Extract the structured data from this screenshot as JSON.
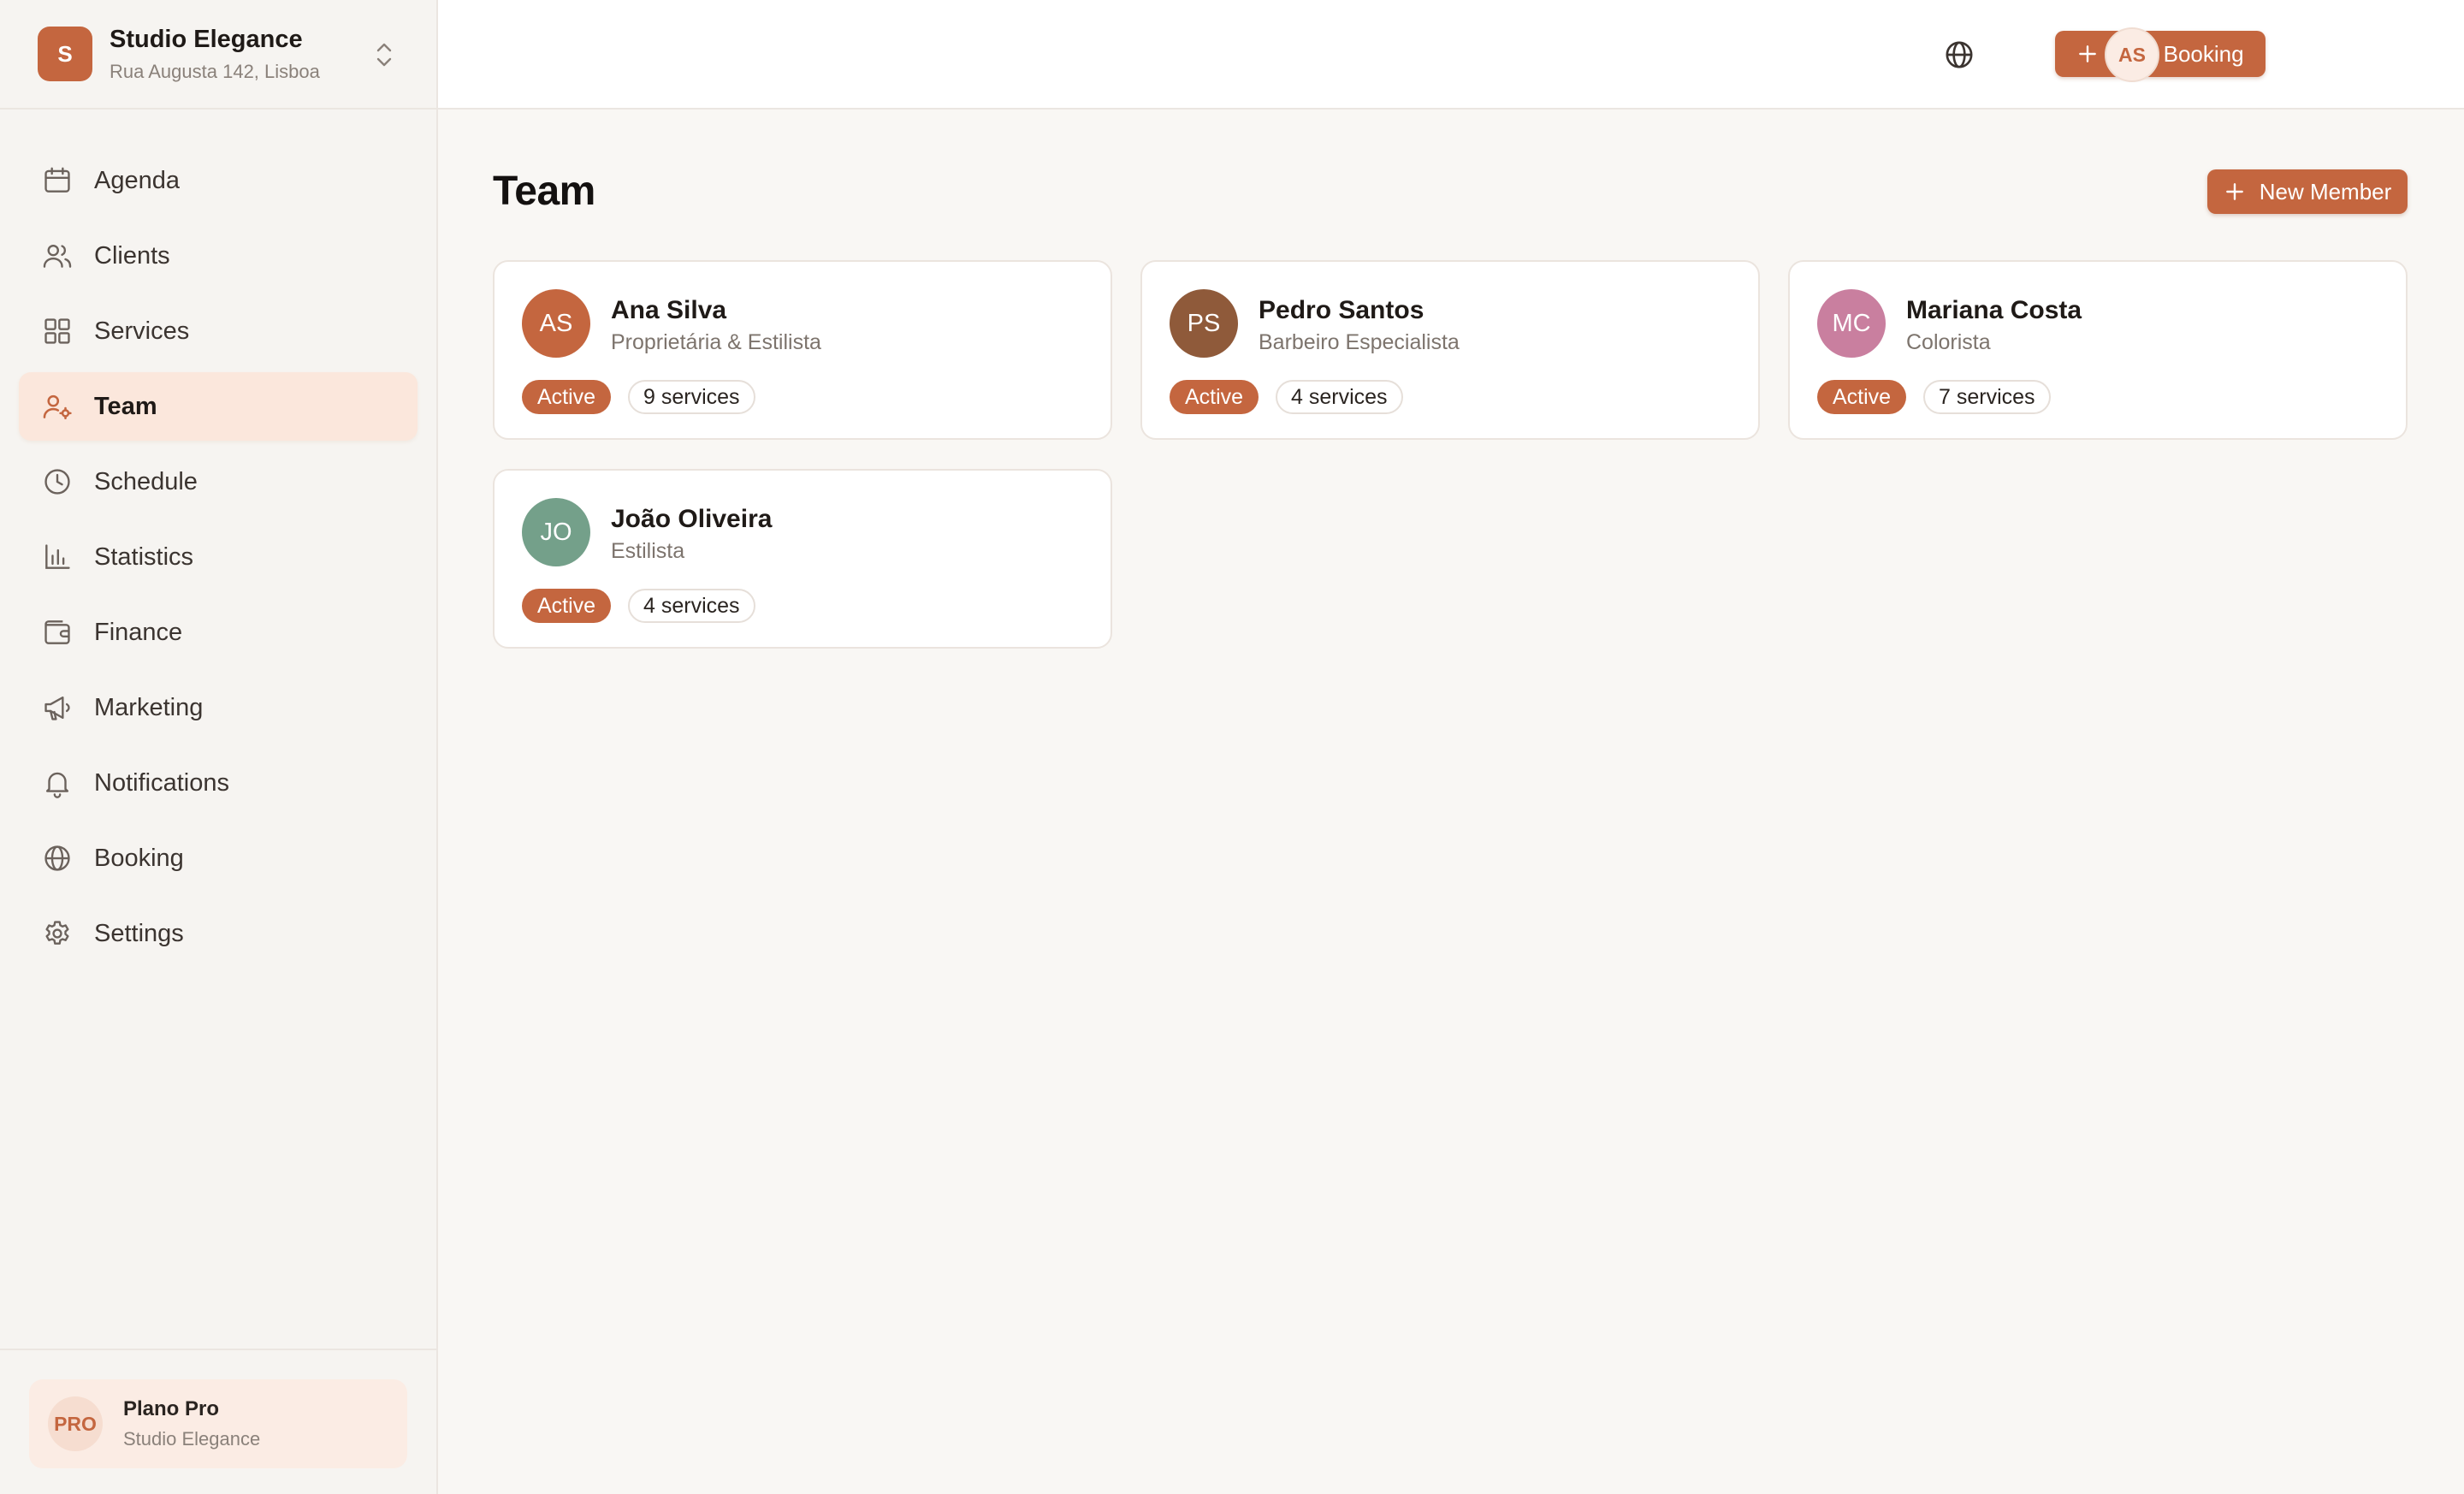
{
  "org": {
    "initial": "S",
    "name": "Studio Elegance",
    "address": "Rua Augusta 142, Lisboa"
  },
  "sidebar": {
    "items": [
      {
        "label": "Agenda",
        "icon": "calendar-icon"
      },
      {
        "label": "Clients",
        "icon": "users-icon"
      },
      {
        "label": "Services",
        "icon": "grid-icon"
      },
      {
        "label": "Team",
        "icon": "user-cog-icon",
        "active": true
      },
      {
        "label": "Schedule",
        "icon": "clock-icon"
      },
      {
        "label": "Statistics",
        "icon": "bar-chart-icon"
      },
      {
        "label": "Finance",
        "icon": "wallet-icon"
      },
      {
        "label": "Marketing",
        "icon": "megaphone-icon"
      },
      {
        "label": "Notifications",
        "icon": "bell-icon"
      },
      {
        "label": "Booking",
        "icon": "globe-icon"
      },
      {
        "label": "Settings",
        "icon": "gear-icon"
      }
    ]
  },
  "plan": {
    "badge": "PRO",
    "name": "Plano Pro",
    "subtitle": "Studio Elegance"
  },
  "topbar": {
    "new_booking_label": "New Booking",
    "user_initials": "AS"
  },
  "page": {
    "title": "Team",
    "new_member_label": "New Member"
  },
  "team": [
    {
      "initials": "AS",
      "name": "Ana Silva",
      "role": "Proprietária & Estilista",
      "status": "Active",
      "services": "9 services",
      "color": "#c4663f"
    },
    {
      "initials": "PS",
      "name": "Pedro Santos",
      "role": "Barbeiro Especialista",
      "status": "Active",
      "services": "4 services",
      "color": "#8f5a3a"
    },
    {
      "initials": "MC",
      "name": "Mariana Costa",
      "role": "Colorista",
      "status": "Active",
      "services": "7 services",
      "color": "#c97f9f"
    },
    {
      "initials": "JO",
      "name": "João Oliveira",
      "role": "Estilista",
      "status": "Active",
      "services": "4 services",
      "color": "#74a08a"
    }
  ],
  "colors": {
    "accent": "#c4663f",
    "sidebar_active_bg": "#fbe7dc",
    "background": "#f9f7f4"
  }
}
